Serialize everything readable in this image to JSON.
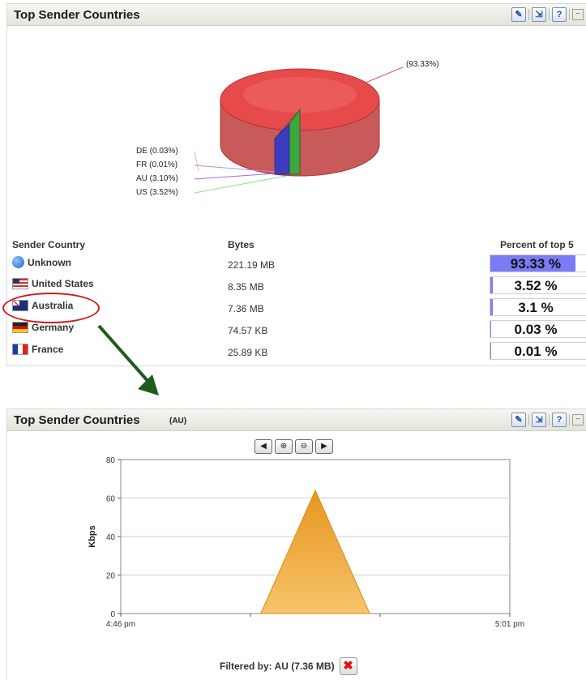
{
  "panel_top": {
    "title": "Top Sender Countries",
    "pie_labels": {
      "unknown": "(93.33%)",
      "de": "DE (0.03%)",
      "fr": "FR (0.01%)",
      "au": "AU (3.10%)",
      "us": "US (3.52%)"
    },
    "table": {
      "headers": [
        "Sender Country",
        "Bytes",
        "Percent of top 5"
      ],
      "rows": [
        {
          "country": "Unknown",
          "flag": "globe-icon",
          "bytes": "221.19 MB",
          "percent": "93.33 %",
          "fraction": 0.9333
        },
        {
          "country": "United States",
          "flag": "us-flag-icon",
          "bytes": "8.35 MB",
          "percent": "3.52 %",
          "fraction": 0.0352
        },
        {
          "country": "Australia",
          "flag": "au-flag-icon",
          "bytes": "7.36 MB",
          "percent": "3.1 %",
          "fraction": 0.031
        },
        {
          "country": "Germany",
          "flag": "de-flag-icon",
          "bytes": "74.57 KB",
          "percent": "0.03 %",
          "fraction": 0.0003
        },
        {
          "country": "France",
          "flag": "fr-flag-icon",
          "bytes": "25.89 KB",
          "percent": "0.01 %",
          "fraction": 0.0001
        }
      ]
    }
  },
  "panel_bottom": {
    "title": "Top Sender Countries",
    "subtitle": "(AU)",
    "filter_text": "Filtered by: AU (7.36 MB)"
  },
  "colors": {
    "pie_unknown": "#e63c3c",
    "pie_us": "#39b54a",
    "pie_au": "#3a3ab8",
    "area_fill": "#f2a93b",
    "percent_bar": "#7b7bf5",
    "highlight": "#d01818",
    "arrow": "#1f5a1f"
  },
  "chart_data": {
    "type": "area",
    "ylabel": "Kbps",
    "xlabel": "",
    "x_tick_labels": [
      "4:46 pm",
      "5:01 pm"
    ],
    "ylim": [
      0,
      80
    ],
    "yticks": [
      0,
      20,
      40,
      60,
      80
    ],
    "series": [
      {
        "points": [
          {
            "t": 0.36,
            "y": 0
          },
          {
            "t": 0.5,
            "y": 64
          },
          {
            "t": 0.64,
            "y": 0
          }
        ]
      }
    ],
    "grid": true
  }
}
